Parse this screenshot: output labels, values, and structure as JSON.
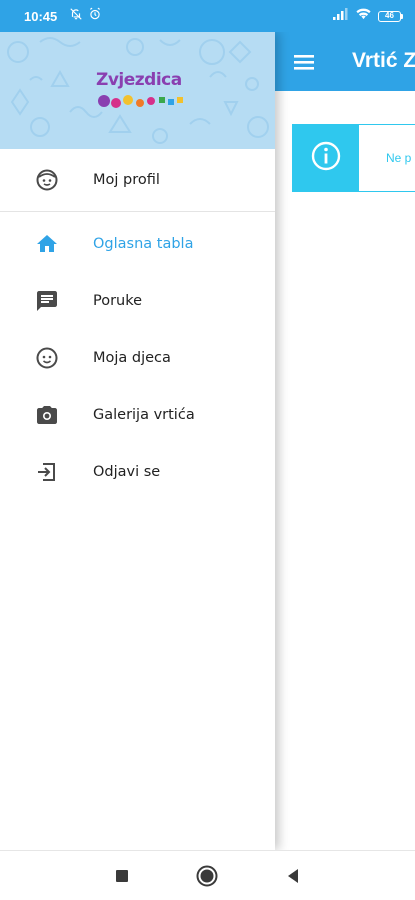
{
  "status_bar": {
    "time": "10:45",
    "battery": "46",
    "icons": [
      "notifications-off-icon",
      "alarm-icon",
      "signal-icon",
      "wifi-icon",
      "battery-icon"
    ]
  },
  "app_bar": {
    "title": "Vrtić Zv",
    "menu_icon": "hamburger-menu-icon"
  },
  "content": {
    "info_text": "Ne p",
    "info_icon": "info-icon"
  },
  "drawer": {
    "logo_text": "Zvjezdica",
    "profile": {
      "label": "Moj profil",
      "icon": "face-icon"
    },
    "items": [
      {
        "label": "Oglasna tabla",
        "icon": "home-icon",
        "active": true
      },
      {
        "label": "Poruke",
        "icon": "message-icon",
        "active": false
      },
      {
        "label": "Moja djeca",
        "icon": "child-face-icon",
        "active": false
      },
      {
        "label": "Galerija vrtića",
        "icon": "camera-icon",
        "active": false
      },
      {
        "label": "Odjavi se",
        "icon": "logout-icon",
        "active": false
      }
    ]
  },
  "colors": {
    "primary": "#2fa3e6",
    "info": "#2fc8ee",
    "header_bg": "#b6dcf3",
    "icon": "#4a4a4a"
  },
  "system_nav": {
    "buttons": [
      "recents-button",
      "home-button",
      "back-button"
    ]
  }
}
